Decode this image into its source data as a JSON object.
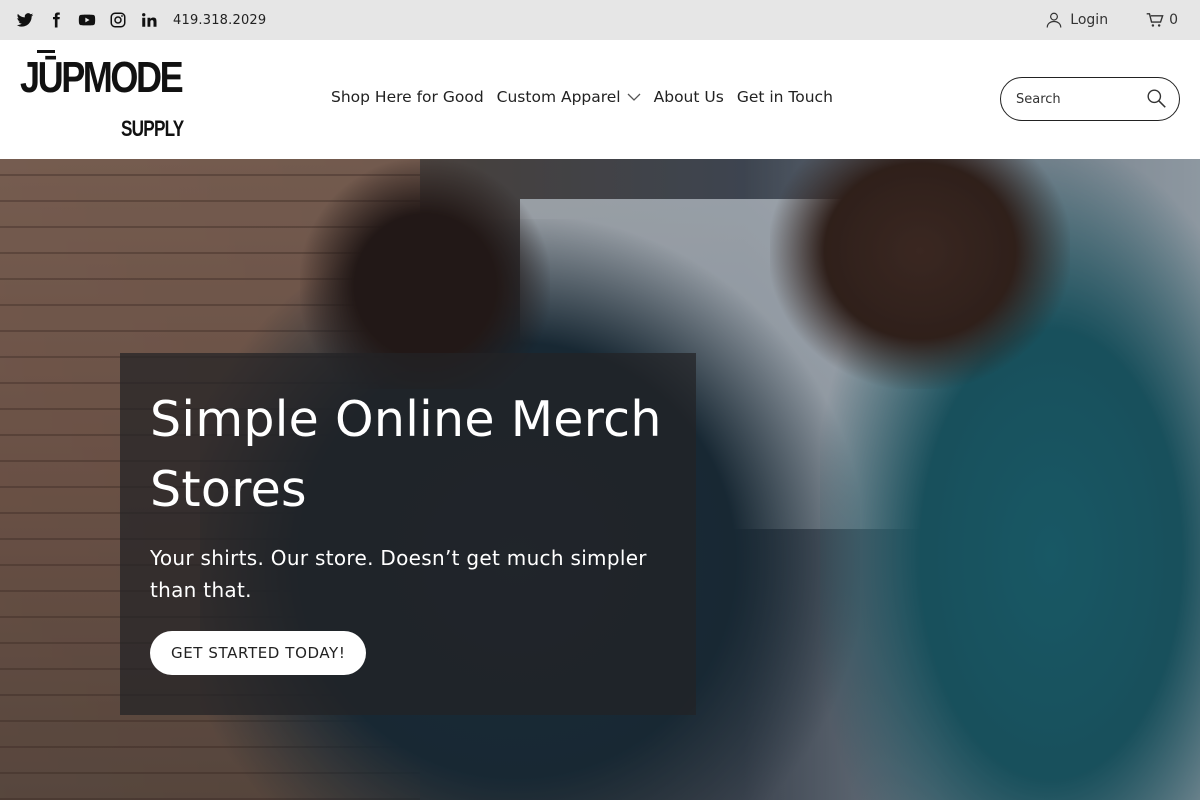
{
  "topbar": {
    "social": [
      {
        "name": "twitter-icon"
      },
      {
        "name": "facebook-icon"
      },
      {
        "name": "youtube-icon"
      },
      {
        "name": "instagram-icon"
      },
      {
        "name": "linkedin-icon"
      }
    ],
    "phone": "419.318.2029",
    "login_label": "Login",
    "cart_count": "0",
    "background_color": "#e6e6e6"
  },
  "header": {
    "logo_main": "JŪPMODE",
    "logo_sub": "SUPPLY",
    "nav": [
      {
        "label": "Shop Here for Good"
      },
      {
        "label": "Custom Apparel",
        "has_dropdown": true
      },
      {
        "label": "About Us"
      },
      {
        "label": "Get in Touch"
      }
    ],
    "search": {
      "placeholder": "Search",
      "value": ""
    }
  },
  "hero": {
    "title": "Simple Online Merch Stores",
    "subtitle": "Your shirts. Our store. Doesn’t get much simpler than that.",
    "cta_label": "GET STARTED TODAY!"
  }
}
